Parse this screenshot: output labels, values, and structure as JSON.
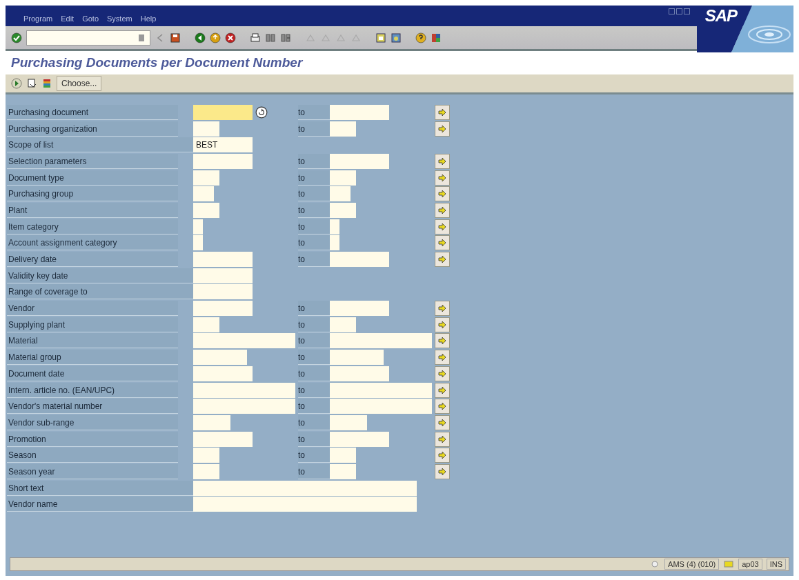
{
  "menu": [
    "Program",
    "Edit",
    "Goto",
    "System",
    "Help"
  ],
  "logo": "SAP",
  "title": "Purchasing Documents per Document Number",
  "app_toolbar": {
    "button": "Choose..."
  },
  "rows": [
    {
      "label": "Purchasing document",
      "kind": "char10",
      "focused": true,
      "range": true,
      "to": "to"
    },
    {
      "label": "Purchasing organization",
      "kind": "char4",
      "focused": false,
      "range": true,
      "to": "to"
    },
    {
      "label": "Scope of list",
      "kind": "char10",
      "focused": false,
      "range": false,
      "value": "BEST"
    },
    {
      "label": "Selection parameters",
      "kind": "char10",
      "focused": false,
      "range": true,
      "to": "to"
    },
    {
      "label": "Document type",
      "kind": "char4",
      "focused": false,
      "range": true,
      "to": "to"
    },
    {
      "label": "Purchasing group",
      "kind": "char3",
      "focused": false,
      "range": true,
      "to": "to"
    },
    {
      "label": "Plant",
      "kind": "char4",
      "focused": false,
      "range": true,
      "to": "to"
    },
    {
      "label": "Item category",
      "kind": "char1",
      "focused": false,
      "range": true,
      "to": "to"
    },
    {
      "label": "Account assignment category",
      "kind": "char1",
      "focused": false,
      "range": true,
      "to": "to"
    },
    {
      "label": "Delivery date",
      "kind": "char10",
      "focused": false,
      "range": true,
      "to": "to"
    },
    {
      "label": "Validity key date",
      "kind": "char10",
      "focused": false,
      "range": false
    },
    {
      "label": "Range of coverage to",
      "kind": "char10",
      "focused": false,
      "range": false
    },
    {
      "label": "Vendor",
      "kind": "char10",
      "focused": false,
      "range": true,
      "to": "to"
    },
    {
      "label": "Supplying plant",
      "kind": "char4",
      "focused": false,
      "range": true,
      "to": "to"
    },
    {
      "label": "Material",
      "kind": "char18",
      "focused": false,
      "range": true,
      "to": "to"
    },
    {
      "label": "Material group",
      "kind": "char9",
      "focused": false,
      "range": true,
      "to": "to"
    },
    {
      "label": "Document date",
      "kind": "char10",
      "focused": false,
      "range": true,
      "to": "to"
    },
    {
      "label": "Intern. article no. (EAN/UPC)",
      "kind": "char18",
      "focused": false,
      "range": true,
      "to": "to"
    },
    {
      "label": "Vendor's material number",
      "kind": "char18",
      "focused": false,
      "range": true,
      "to": "to"
    },
    {
      "label": "Vendor sub-range",
      "kind": "char6",
      "focused": false,
      "range": true,
      "to": "to"
    },
    {
      "label": "Promotion",
      "kind": "char10",
      "focused": false,
      "range": true,
      "to": "to"
    },
    {
      "label": "Season",
      "kind": "char4",
      "focused": false,
      "range": true,
      "to": "to"
    },
    {
      "label": "Season year",
      "kind": "char4",
      "focused": false,
      "range": true,
      "to": "to"
    },
    {
      "label": "Short text",
      "kind": "char40",
      "focused": false,
      "range": false
    },
    {
      "label": "Vendor name",
      "kind": "char40",
      "focused": false,
      "range": false
    }
  ],
  "status_bar": {
    "system": "AMS (4) (010)",
    "server": "ap03",
    "mode": "INS"
  }
}
